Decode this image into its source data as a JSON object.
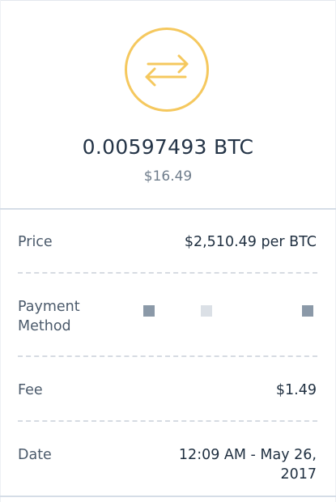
{
  "transaction": {
    "amount": "0.00597493 BTC",
    "fiat_value": "$16.49"
  },
  "details": {
    "price": {
      "label": "Price",
      "value": "$2,510.49 per BTC"
    },
    "payment_method": {
      "label_line1": "Payment",
      "label_line2": "Method",
      "value": ""
    },
    "fee": {
      "label": "Fee",
      "value": "$1.49"
    },
    "date": {
      "label": "Date",
      "value_line1": "12:09 AM - May 26,",
      "value_line2": "2017"
    }
  },
  "colors": {
    "accent_gold": "#F5C85E",
    "primary_text": "#243447",
    "secondary_text": "#6f7d8c",
    "divider": "#d5dde7"
  },
  "icons": {
    "header_icon": "transfer-arrows-icon"
  }
}
